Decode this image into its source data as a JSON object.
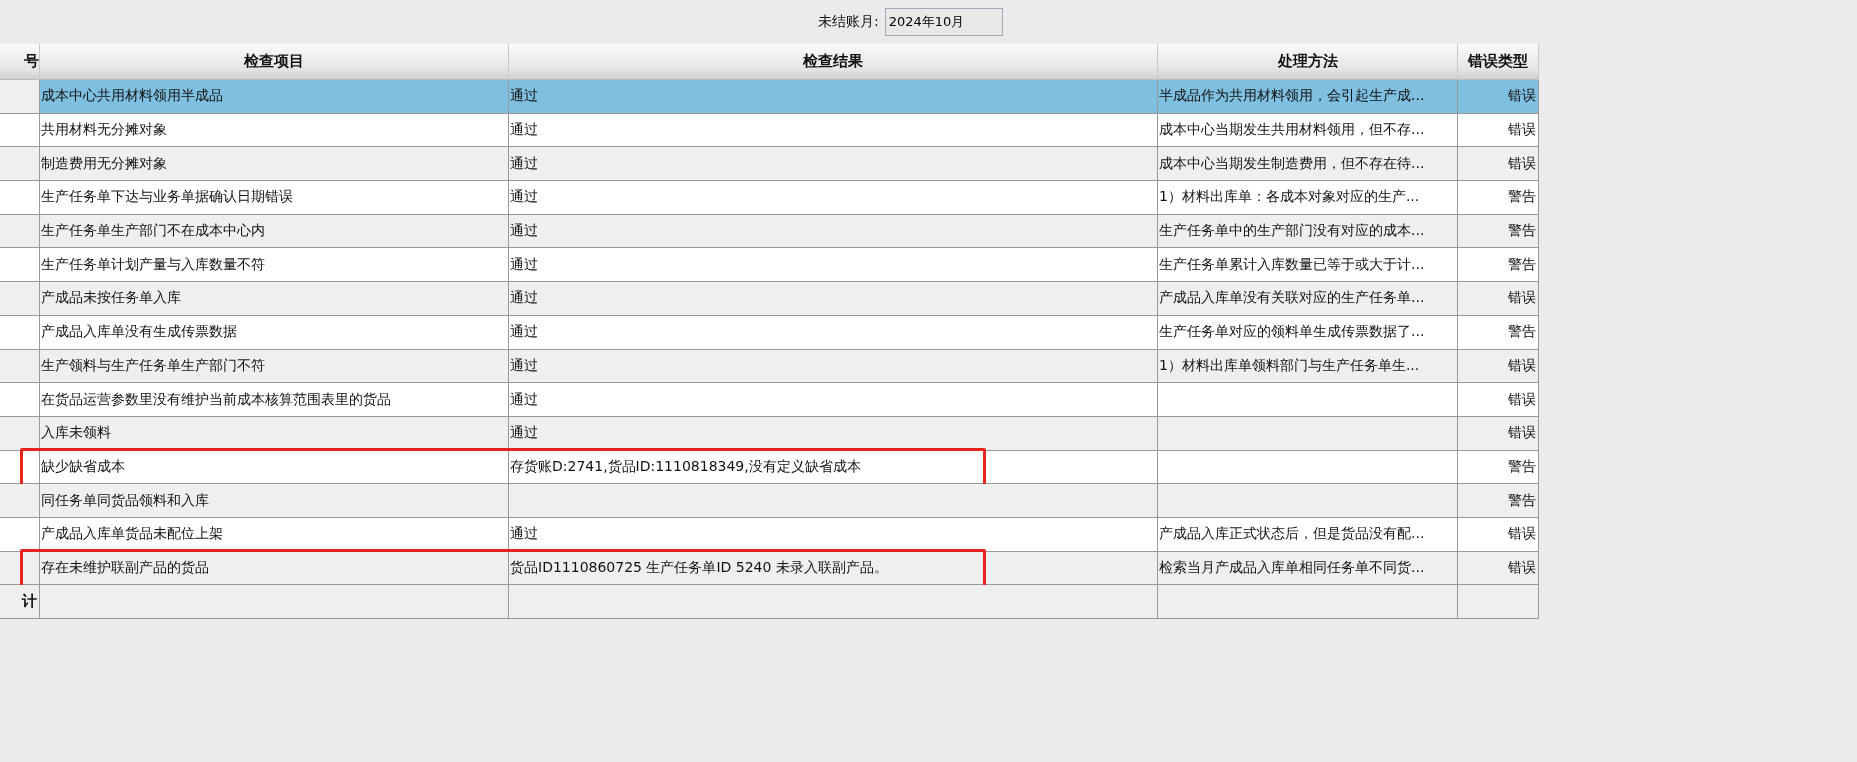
{
  "period": {
    "label": "未结账月:",
    "value": "2024年10月"
  },
  "table": {
    "columns": [
      "号",
      "检查项目",
      "检查结果",
      "处理方法",
      "错误类型"
    ],
    "rows": [
      {
        "item": "成本中心共用材料领用半成品",
        "result": "通过",
        "method": "半成品作为共用材料领用，会引起生产成...",
        "type": "错误",
        "selected": true,
        "marked": false
      },
      {
        "item": "共用材料无分摊对象",
        "result": "通过",
        "method": "成本中心当期发生共用材料领用，但不存...",
        "type": "错误",
        "selected": false,
        "marked": false
      },
      {
        "item": "制造费用无分摊对象",
        "result": "通过",
        "method": "成本中心当期发生制造费用，但不存在待...",
        "type": "错误",
        "selected": false,
        "marked": false
      },
      {
        "item": "生产任务单下达与业务单据确认日期错误",
        "result": "通过",
        "method": "1）材料出库单：各成本对象对应的生产...",
        "type": "警告",
        "selected": false,
        "marked": false
      },
      {
        "item": "生产任务单生产部门不在成本中心内",
        "result": "通过",
        "method": "生产任务单中的生产部门没有对应的成本...",
        "type": "警告",
        "selected": false,
        "marked": false
      },
      {
        "item": "生产任务单计划产量与入库数量不符",
        "result": "通过",
        "method": "生产任务单累计入库数量已等于或大于计...",
        "type": "警告",
        "selected": false,
        "marked": false
      },
      {
        "item": "产成品未按任务单入库",
        "result": "通过",
        "method": "产成品入库单没有关联对应的生产任务单...",
        "type": "错误",
        "selected": false,
        "marked": false
      },
      {
        "item": "产成品入库单没有生成传票数据",
        "result": "通过",
        "method": "生产任务单对应的领料单生成传票数据了...",
        "type": "警告",
        "selected": false,
        "marked": false
      },
      {
        "item": "生产领料与生产任务单生产部门不符",
        "result": "通过",
        "method": "1）材料出库单领料部门与生产任务单生...",
        "type": "错误",
        "selected": false,
        "marked": false
      },
      {
        "item": "在货品运营参数里没有维护当前成本核算范围表里的货品",
        "result": "通过",
        "type": "错误",
        "selected": false,
        "marked": false
      },
      {
        "item": "入库未领料",
        "result": "通过",
        "type": "错误",
        "selected": false,
        "marked": false
      },
      {
        "item": "缺少缺省成本",
        "result": "存货账D:2741,货品ID:1110818349,没有定义缺省成本",
        "type": "警告",
        "selected": false,
        "marked": true
      },
      {
        "item": "同任务单同货品领料和入库",
        "type": "警告",
        "selected": false,
        "marked": false
      },
      {
        "item": "产成品入库单货品未配位上架",
        "result": "通过",
        "method": "产成品入库正式状态后，但是货品没有配...",
        "type": "错误",
        "selected": false,
        "marked": false
      },
      {
        "item": "存在未维护联副产品的货品",
        "result": "货品ID1110860725 生产任务单ID 5240 未录入联副产品。",
        "method": "检索当月产成品入库单相同任务单不同货...",
        "type": "错误",
        "selected": false,
        "marked": true
      }
    ],
    "total_label": "计"
  }
}
